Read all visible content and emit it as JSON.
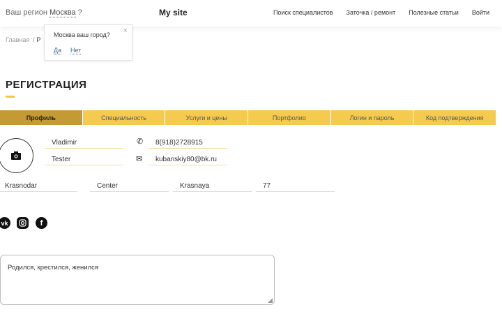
{
  "header": {
    "region_label": "Ваш регион",
    "region_city": "Москва",
    "region_q": "?",
    "logo": "My site",
    "nav": [
      "Поиск специалистов",
      "Заточка / ремонт",
      "Полезные статьи",
      "Войти"
    ]
  },
  "breadcrumb": {
    "home": "Главная",
    "sep": "/",
    "current": "Р"
  },
  "popup": {
    "question": "Москва ваш город?",
    "yes": "Да",
    "no": "Нет",
    "close": "×"
  },
  "page_title": "РЕГИСТРАЦИЯ",
  "tabs": [
    "Профиль",
    "Специальность",
    "Услуги и цены",
    "Портфолио",
    "Логин и пароль",
    "Код подтверждения"
  ],
  "profile": {
    "first_name": "Vladimir",
    "last_name": "Tester",
    "phone": "8(918)2728915",
    "email": "kubanskiy80@bk.ru",
    "city": "Krasnodar",
    "district": "Center",
    "street": "Krasnaya",
    "house": "77"
  },
  "about": "Родился, крестился, женился",
  "colors": {
    "accent": "#f5cb4f",
    "active_tab": "#c49a35"
  }
}
